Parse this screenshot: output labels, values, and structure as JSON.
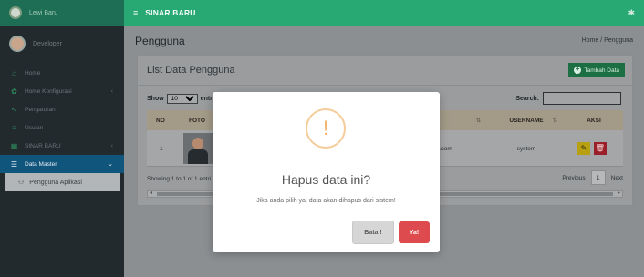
{
  "sidebar": {
    "brand": "Lewi Baru",
    "user_name": "Developer",
    "items": [
      {
        "label": "Home",
        "icon": "home-icon",
        "glyph": "⌂",
        "chev": ""
      },
      {
        "label": "Home Konfigurasi",
        "icon": "cogs-icon",
        "glyph": "✿",
        "chev": "‹"
      },
      {
        "label": "Pengaturan",
        "icon": "cursor-icon",
        "glyph": "↖",
        "chev": ""
      },
      {
        "label": "Usulan",
        "icon": "list-icon",
        "glyph": "≡",
        "chev": ""
      },
      {
        "label": "SINAR BARU",
        "icon": "building-icon",
        "glyph": "▦",
        "chev": "‹"
      },
      {
        "label": "Data Master",
        "icon": "database-icon",
        "glyph": "☰",
        "chev": "⌄"
      }
    ],
    "submenu_label": "Pengguna Aplikasi"
  },
  "topbar": {
    "title": "SINAR BARU"
  },
  "page": {
    "title": "Pengguna",
    "breadcrumb": "Home / Pengguna"
  },
  "panel": {
    "title": "List Data Pengguna",
    "add_button": "Tambah Data",
    "show_label": "Show",
    "entries_value": "10",
    "entries_label": "entries",
    "search_label": "Search:",
    "search_value": ""
  },
  "table": {
    "headers": {
      "no": "NO",
      "foto": "FOTO",
      "username": "USERNAME",
      "aksi": "AKSI"
    },
    "rows": [
      {
        "no": "1",
        "email_partial": "zer.com",
        "username": "system"
      }
    ]
  },
  "footer": {
    "info": "Showing 1 to 1 of 1 entri",
    "previous": "Previous",
    "page": "1",
    "next": "Next"
  },
  "modal": {
    "icon_symbol": "!",
    "title": "Hapus data ini?",
    "message": "Jika anda pilih ya, data akan dihapus dari sistem!",
    "cancel": "Batal!",
    "confirm": "Ya!"
  },
  "colors": {
    "topbar": "#28a872",
    "sidebar": "#232a2e",
    "active_menu": "#10557c",
    "confirm": "#de4b4e",
    "warning": "#f2b46a"
  }
}
